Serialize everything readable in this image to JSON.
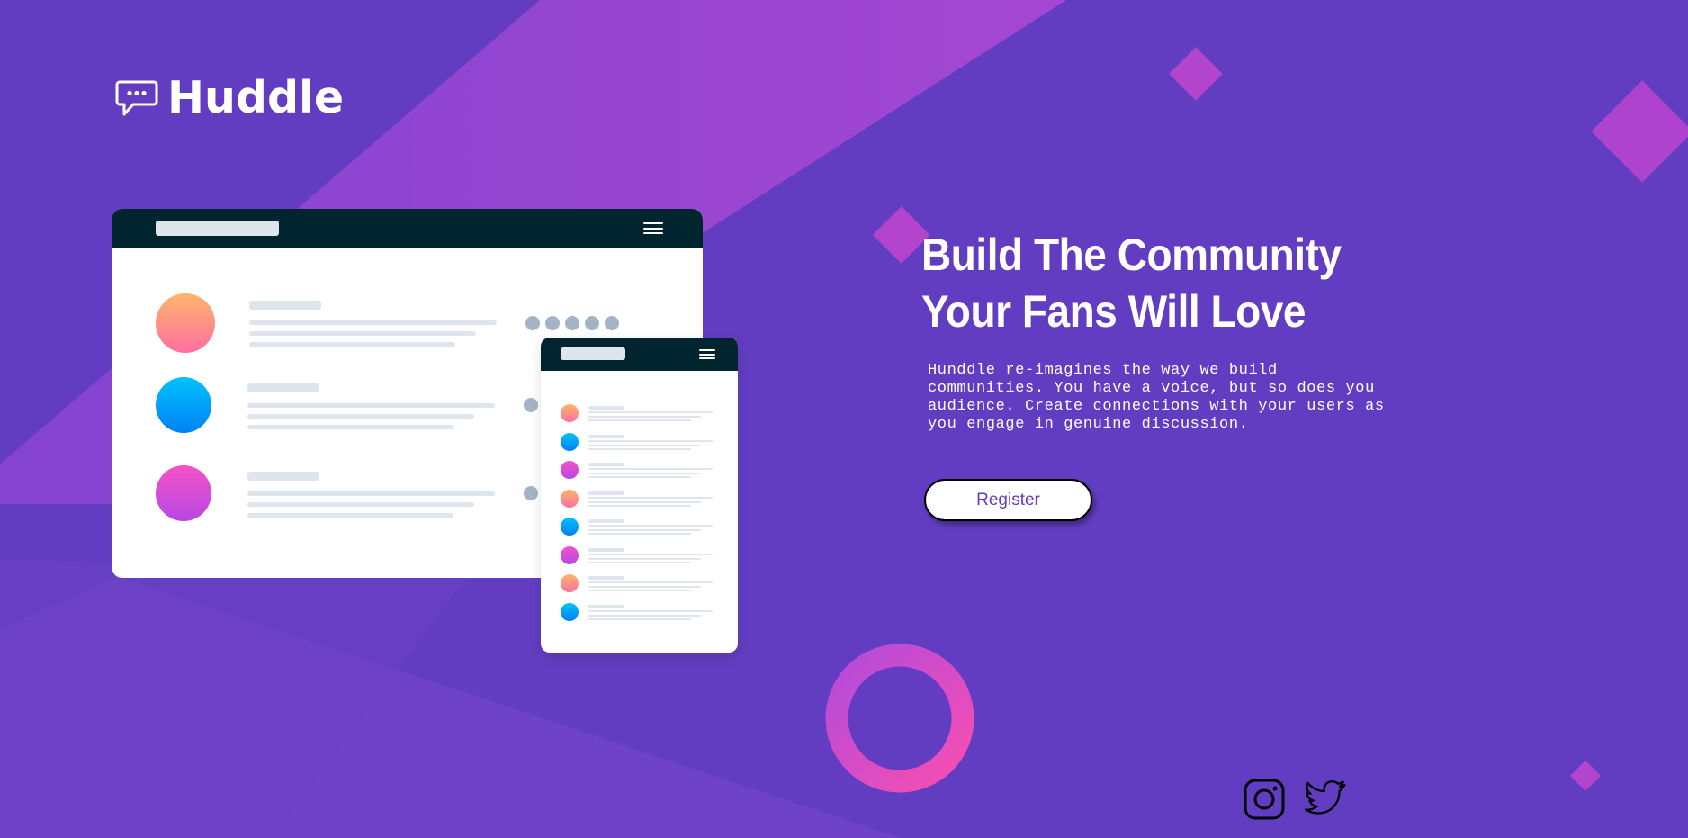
{
  "brand": {
    "name": "Huddle",
    "icon": "chat-bubble-icon"
  },
  "colors": {
    "background": "#623dc1",
    "accent_pink": "#f84eb1",
    "accent_purple": "#b34bdb",
    "mockup_bar": "#00252e",
    "placeholder": "#dfe5ec"
  },
  "hero": {
    "title_line1": "Build The Community",
    "title_line2": "Your Fans Will Love",
    "description": "Hunddle re-imagines the way we build communities. You have a voice, but so does you audience. Create connections with your users as you engage in genuine discussion.",
    "register_label": "Register"
  },
  "social": [
    {
      "name": "Instagram",
      "icon": "instagram-icon"
    },
    {
      "name": "Twitter",
      "icon": "twitter-icon"
    }
  ]
}
